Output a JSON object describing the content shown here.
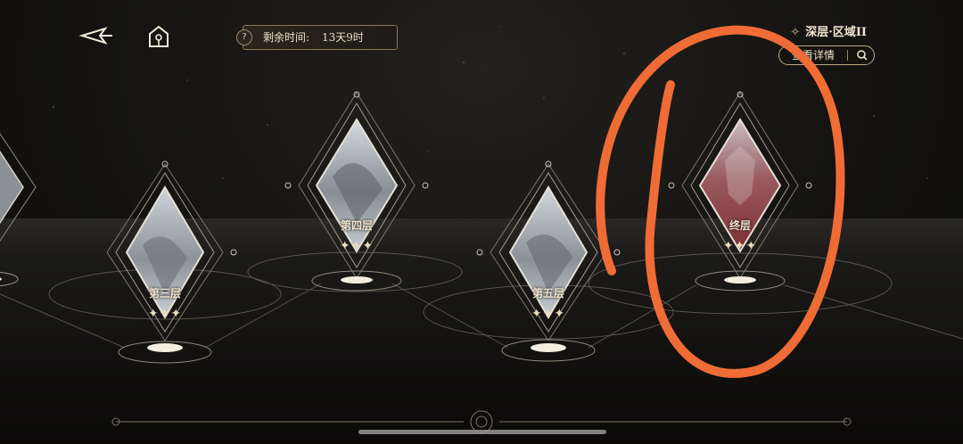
{
  "header": {
    "timer_help_icon": "?",
    "timer_label": "剩余时间:",
    "timer_value": "13天9时",
    "region_title": "深层·区域II",
    "detail_button_label": "查看详情"
  },
  "levels": [
    {
      "label": "",
      "stars": ""
    },
    {
      "label": "第三层",
      "stars": "✦✦✦"
    },
    {
      "label": "第四层",
      "stars": "✦✦✦"
    },
    {
      "label": "第五层",
      "stars": "✦✦✦"
    },
    {
      "label": "终层",
      "stars": "✦✦✦"
    }
  ],
  "icons": {
    "back": "back-arrow-icon",
    "home": "home-icon",
    "search": "magnifier-icon",
    "sparkle": "sparkle-icon"
  },
  "colors": {
    "accent_gold": "#c9b48a",
    "final_node": "#8e3b3e",
    "annotation": "#ef6c35"
  }
}
